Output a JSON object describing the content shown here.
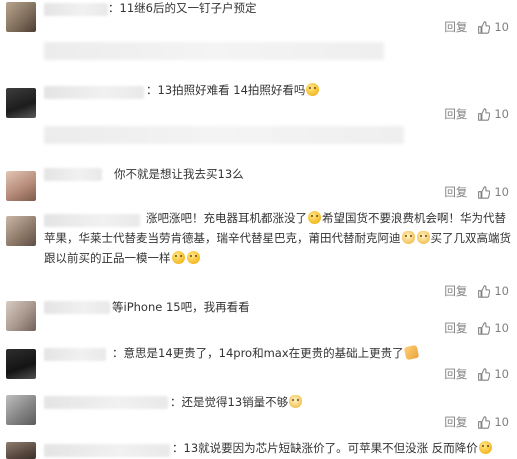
{
  "comments": [
    {
      "text_parts": [
        "11继6后的又一钉子户预定"
      ],
      "reply_label": "回复",
      "likes": "10"
    },
    {
      "text_parts": [
        "13拍照好难看 14拍照好看吗"
      ],
      "reply_label": "回复",
      "likes": "10"
    },
    {
      "text_parts": [
        "你不就是想让我去买13么"
      ],
      "reply_label": "回复",
      "likes": "10"
    },
    {
      "text_parts": [
        "涨吧涨吧！充电器耳机都涨没了",
        "希望国货不要浪费机会啊！华为代替苹果，华莱士代替麦当劳肯德基，瑞辛代替星巴克，莆田代替耐克阿迪",
        "买了几双高端货跟以前买的正品一模一样"
      ],
      "reply_label": "回复",
      "likes": "10"
    },
    {
      "text_parts": [
        "等iPhone 15吧，我再看看"
      ],
      "reply_label": "回复",
      "likes": "10"
    },
    {
      "text_parts": [
        "意思是14更贵了，14pro和max在更贵的基础上更贵了"
      ],
      "reply_label": "回复",
      "likes": "10"
    },
    {
      "text_parts": [
        "还是觉得13销量不够"
      ],
      "reply_label": "回复",
      "likes": "10"
    },
    {
      "text_parts": [
        "13就说要因为芯片短缺涨价了。可苹果不但没涨 反而降价"
      ]
    }
  ],
  "icons": {
    "like": "thumbs-up-icon"
  },
  "colors": {
    "action_text": "#808080",
    "body_text": "#333333"
  }
}
